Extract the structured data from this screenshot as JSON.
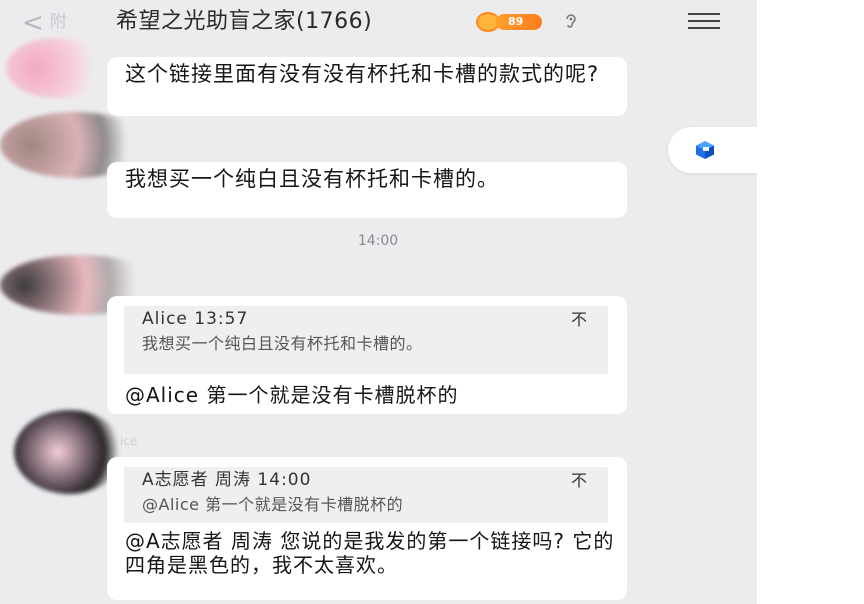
{
  "header": {
    "back_glyph": "<",
    "back_text": "附",
    "title": "希望之光助盲之家(1766)",
    "level_badge": "89",
    "icons": [
      "chevron-left-icon",
      "level-badge-icon",
      "ear-icon",
      "menu-icon"
    ]
  },
  "messages": [
    {
      "type": "text",
      "text": "这个链接里面有没有没有杯托和卡槽的款式的呢?"
    },
    {
      "type": "text",
      "text": "我想买一个纯白且没有杯托和卡槽的。"
    },
    {
      "type": "time",
      "text": "14:00"
    },
    {
      "type": "reply",
      "quote_head": "Alice 13:57",
      "quote_action": "不",
      "quote_body": "我想买一个纯白且没有杯托和卡槽的。",
      "text": "@Alice 第一个就是没有卡槽脱杯的"
    },
    {
      "type": "reply",
      "sender_hint": "ice",
      "quote_head": "A志愿者 周涛 14:00",
      "quote_action": "不",
      "quote_body": "@Alice 第一个就是没有卡槽脱杯的",
      "text": "@A志愿者 周涛 您说的是我发的第一个链接吗? 它的四角是黑色的，我不太喜欢。"
    }
  ],
  "colors": {
    "background": "#ececef",
    "bubble": "#ffffff",
    "quote": "#efeff1",
    "badge": "#ff8a1c",
    "float_icon": "#1f6fe5"
  }
}
